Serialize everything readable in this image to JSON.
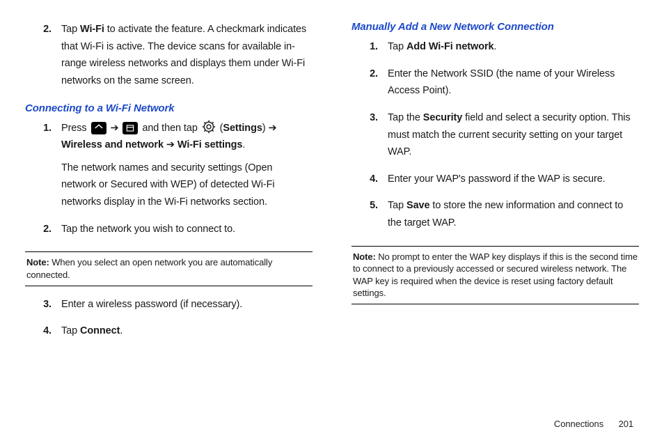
{
  "left": {
    "intro_step": {
      "num": "2.",
      "pre": "Tap ",
      "bold": "Wi-Fi",
      "post": " to activate the feature. A checkmark indicates that Wi-Fi is active. The device scans for available in-range wireless networks and displays them under Wi-Fi networks on the same screen."
    },
    "heading1": "Connecting to a Wi-Fi Network",
    "step1": {
      "num": "1.",
      "t1": "Press ",
      "t2": " ➔ ",
      "t3": " and then tap ",
      "t4": " (",
      "bold_settings": "Settings",
      "t5": ") ➔ ",
      "bold_wn": "Wireless and network",
      "t6": " ➔ ",
      "bold_wifi": "Wi-Fi settings",
      "t7": ".",
      "follow": "The network names and security settings (Open network or Secured with WEP) of detected Wi-Fi networks display in the Wi-Fi networks section."
    },
    "step2": {
      "num": "2.",
      "text": "Tap the network you wish to connect to."
    },
    "note1": {
      "label": "Note:",
      "text": " When you select an open network you are automatically connected."
    },
    "step3": {
      "num": "3.",
      "text": "Enter a wireless password (if necessary)."
    },
    "step4": {
      "num": "4.",
      "pre": "Tap ",
      "bold": "Connect",
      "post": "."
    }
  },
  "right": {
    "heading": "Manually Add a New Network Connection",
    "step1": {
      "num": "1.",
      "pre": "Tap ",
      "bold": "Add Wi-Fi network",
      "post": "."
    },
    "step2": {
      "num": "2.",
      "text": "Enter the Network SSID (the name of your Wireless Access Point)."
    },
    "step3": {
      "num": "3.",
      "pre": "Tap the ",
      "bold": "Security",
      "post": " field and select a security option. This must match the current security setting on your target WAP."
    },
    "step4": {
      "num": "4.",
      "text": "Enter your WAP's password if the WAP is secure."
    },
    "step5": {
      "num": "5.",
      "pre": "Tap ",
      "bold": "Save",
      "post": " to store the new information and connect to the target WAP."
    },
    "note": {
      "label": "Note:",
      "text": " No prompt to enter the WAP key displays if this is the second time to connect to a previously accessed or secured wireless network. The WAP key is required when the device is reset using factory default settings."
    }
  },
  "footer": {
    "section": "Connections",
    "page": "201"
  }
}
